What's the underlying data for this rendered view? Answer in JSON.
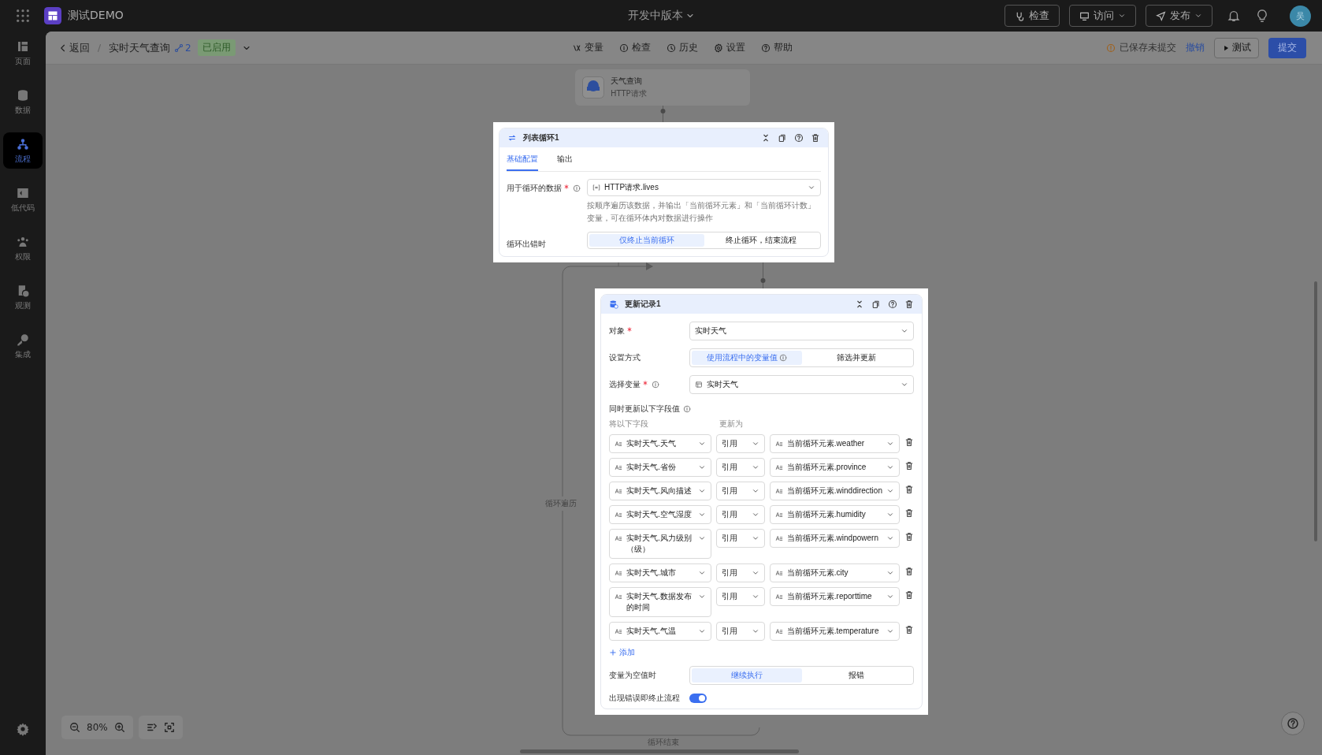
{
  "topbar": {
    "app_name": "测试DEMO",
    "version": "开发中版本",
    "buttons": [
      {
        "label": "检查",
        "dropdown": false
      },
      {
        "label": "访问",
        "dropdown": true
      },
      {
        "label": "发布",
        "dropdown": true
      }
    ],
    "avatar": "吴"
  },
  "sidebar": {
    "items": [
      {
        "label": "页面",
        "selected": false
      },
      {
        "label": "数据",
        "selected": false
      },
      {
        "label": "流程",
        "selected": true
      },
      {
        "label": "低代码",
        "selected": false
      },
      {
        "label": "权限",
        "selected": false
      },
      {
        "label": "观测",
        "selected": false
      },
      {
        "label": "集成",
        "selected": false
      }
    ]
  },
  "header": {
    "back": "返回",
    "flow_name": "实时天气查询",
    "version_count": "2",
    "status": "已启用",
    "tools": [
      "变量",
      "检查",
      "历史",
      "设置",
      "帮助"
    ],
    "save_status": "已保存未提交",
    "revert": "撤销",
    "test": "测试",
    "submit": "提交"
  },
  "canvas": {
    "http_node": {
      "title": "天气查询",
      "subtitle": "HTTP请求"
    },
    "loop_label": "循环遍历",
    "loop_end_label": "循环结束",
    "zoom": "80%"
  },
  "loop_panel": {
    "title": "列表循环1",
    "tabs": [
      {
        "label": "基础配置",
        "selected": true
      },
      {
        "label": "输出",
        "selected": false
      }
    ],
    "data_field": {
      "label": "用于循环的数据",
      "required": true,
      "info": true,
      "value": "HTTP请求.lives",
      "help": "按顺序遍历该数据，并输出「当前循环元素」和「当前循环计数」变量，可在循环体内对数据进行操作"
    },
    "on_error": {
      "label": "循环出错时",
      "options": [
        {
          "label": "仅终止当前循环",
          "selected": true
        },
        {
          "label": "终止循环，结束流程",
          "selected": false
        }
      ]
    }
  },
  "update_panel": {
    "title": "更新记录1",
    "object": {
      "label": "对象",
      "required": true,
      "value": "实时天气"
    },
    "mode": {
      "label": "设置方式",
      "options": [
        {
          "label": "使用流程中的变量值",
          "selected": true,
          "info": true
        },
        {
          "label": "筛选并更新",
          "selected": false,
          "info": false
        }
      ]
    },
    "variable": {
      "label": "选择变量",
      "required": true,
      "info": true,
      "value": "实时天气"
    },
    "fields_title": "同时更新以下字段值",
    "fields_header": [
      "将以下字段",
      "更新为"
    ],
    "rows": [
      {
        "field": "实时天气.天气",
        "mode": "引用",
        "value": "当前循环元素.weather"
      },
      {
        "field": "实时天气.省份",
        "mode": "引用",
        "value": "当前循环元素.province"
      },
      {
        "field": "实时天气.风向描述",
        "mode": "引用",
        "value": "当前循环元素.winddirection"
      },
      {
        "field": "实时天气.空气湿度",
        "mode": "引用",
        "value": "当前循环元素.humidity"
      },
      {
        "field": "实时天气.风力级别（级）",
        "mode": "引用",
        "value": "当前循环元素.windpowern"
      },
      {
        "field": "实时天气.城市",
        "mode": "引用",
        "value": "当前循环元素.city"
      },
      {
        "field": "实时天气.数据发布的时间",
        "mode": "引用",
        "value": "当前循环元素.reporttime"
      },
      {
        "field": "实时天气.气温",
        "mode": "引用",
        "value": "当前循环元素.temperature"
      }
    ],
    "add": "添加",
    "on_empty": {
      "label": "变量为空值时",
      "options": [
        {
          "label": "继续执行",
          "selected": true
        },
        {
          "label": "报错",
          "selected": false
        }
      ]
    },
    "stop_on_error": {
      "label": "出现错误即终止流程",
      "on": true
    }
  }
}
